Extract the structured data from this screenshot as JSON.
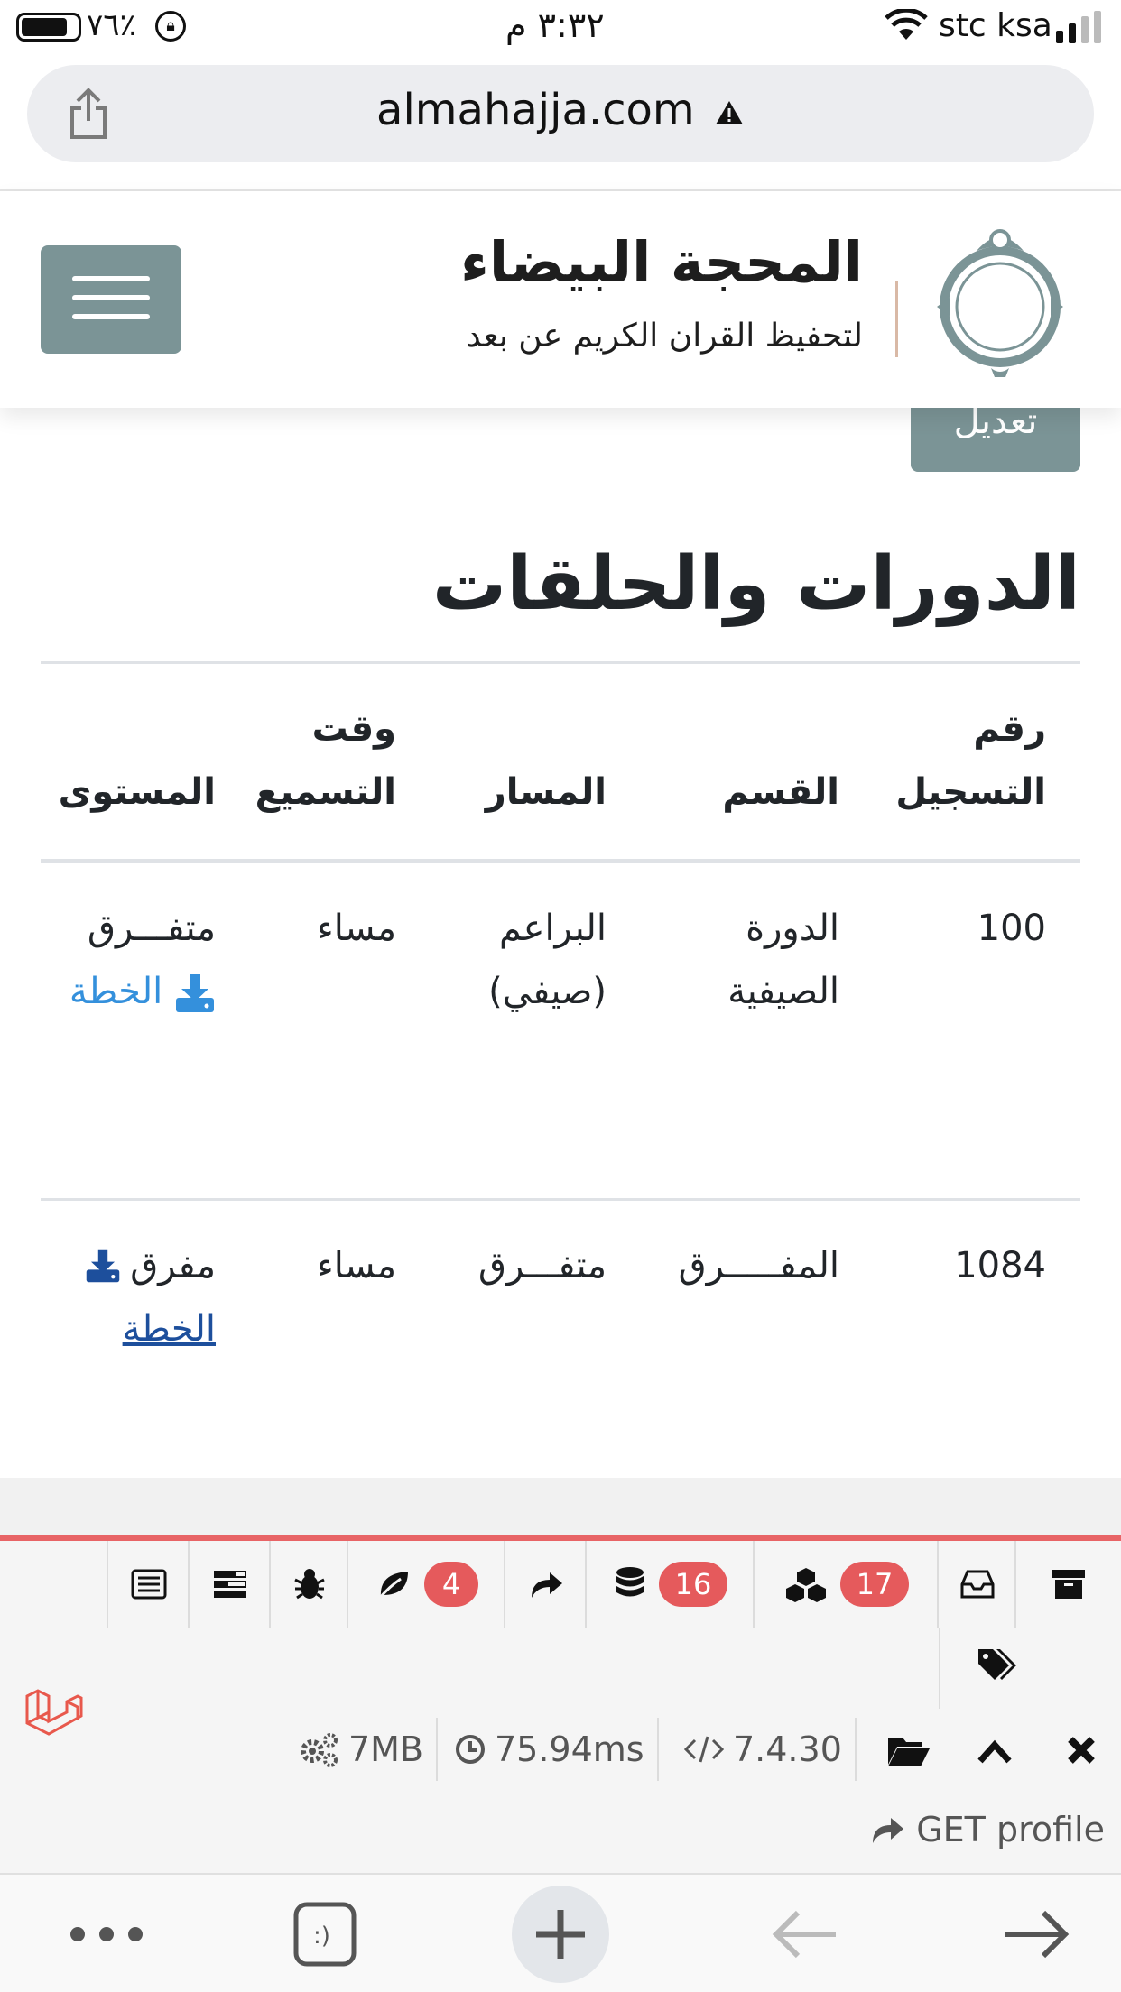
{
  "status_bar": {
    "battery": "٧٦٪",
    "time": "٣:٣٢ م",
    "carrier": "stc ksa"
  },
  "browser": {
    "url": "almahajja.com"
  },
  "header": {
    "site_name": "المحجة البيضاء",
    "tagline": "لتحفيظ القران الكريم عن بعد"
  },
  "page": {
    "edit_label": "تعديل",
    "heading": "الدورات والحلقات"
  },
  "table": {
    "columns": {
      "reg_line1": "رقم",
      "reg_line2": "التسجيل",
      "section": "القسم",
      "track": "المسار",
      "time_line1": "وقت",
      "time_line2": "التسميع",
      "level": "المستوى"
    },
    "rows": [
      {
        "reg": "100",
        "section_line1": "الدورة",
        "section_line2": "الصيفية",
        "track_line1": "البراعم",
        "track_line2": "(صيفي)",
        "time": "مساء",
        "level": "متفـــرق",
        "plan": "الخطة"
      },
      {
        "reg": "1084",
        "section": "المفـــــرق",
        "track": "متفـــرق",
        "time": "مساء",
        "level": "مفرق",
        "plan": "الخطة"
      }
    ]
  },
  "debugbar": {
    "badges": {
      "leaf": "4",
      "database": "16",
      "cubes": "17"
    },
    "memory": "7MB",
    "duration": "75.94ms",
    "php_version": "7.4.30",
    "route": "GET profile"
  },
  "colors": {
    "accent_gray": "#7b9496",
    "link_blue": "#3490dc",
    "debug_red": "#e55a5c"
  }
}
